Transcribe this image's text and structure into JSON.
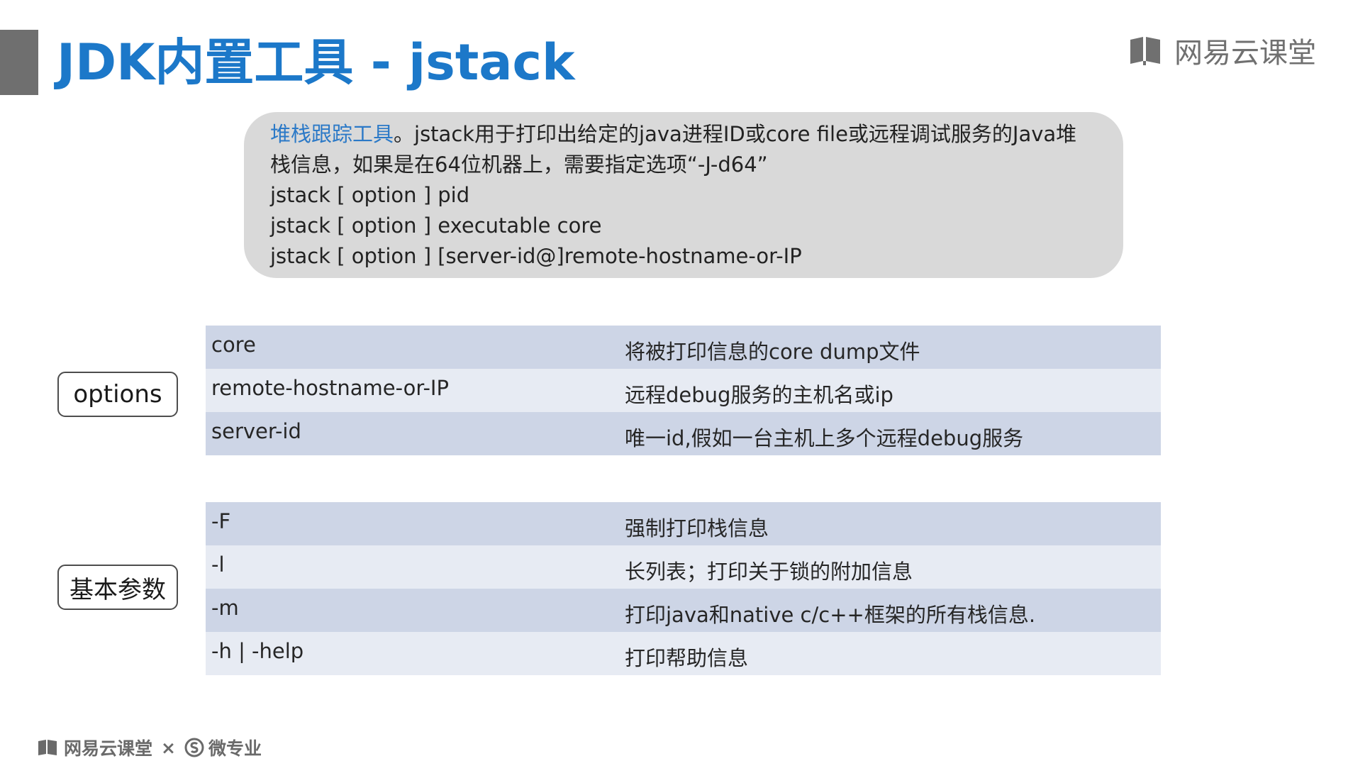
{
  "slide": {
    "title": "JDK内置工具 - jstack"
  },
  "brand": {
    "name": "网易云课堂",
    "icon": "book-logo-icon"
  },
  "description": {
    "highlight": "堆栈跟踪工具",
    "text": "。jstack用于打印出给定的java进程ID或core file或远程调试服务的Java堆栈信息，如果是在64位机器上，需要指定选项“-J-d64”",
    "usage": [
      "jstack [ option ] pid",
      "jstack [ option ] executable core",
      "jstack [ option ] [server-id@]remote-hostname-or-IP"
    ]
  },
  "options_table": {
    "label": "options",
    "rows": [
      {
        "name": "core",
        "desc": "将被打印信息的core dump文件"
      },
      {
        "name": "remote-hostname-or-IP",
        "desc": "远程debug服务的主机名或ip"
      },
      {
        "name": "server-id",
        "desc": "唯一id,假如一台主机上多个远程debug服务"
      }
    ]
  },
  "params_table": {
    "label": "基本参数",
    "rows": [
      {
        "name": "-F",
        "desc": "强制打印栈信息"
      },
      {
        "name": "-l",
        "desc": "长列表；打印关于锁的附加信息"
      },
      {
        "name": "-m",
        "desc": "打印java和native c/c++框架的所有栈信息."
      },
      {
        "name": "-h | -help",
        "desc": "打印帮助信息"
      }
    ]
  },
  "footer": {
    "brand": "网易云课堂",
    "separator": "×",
    "partner": "微专业"
  },
  "colors": {
    "title": "#1c78c9",
    "highlight": "#2b79c7",
    "row_dark": "#cdd5e6",
    "row_light": "#e7ebf3",
    "bubble": "#d9d9d9"
  }
}
